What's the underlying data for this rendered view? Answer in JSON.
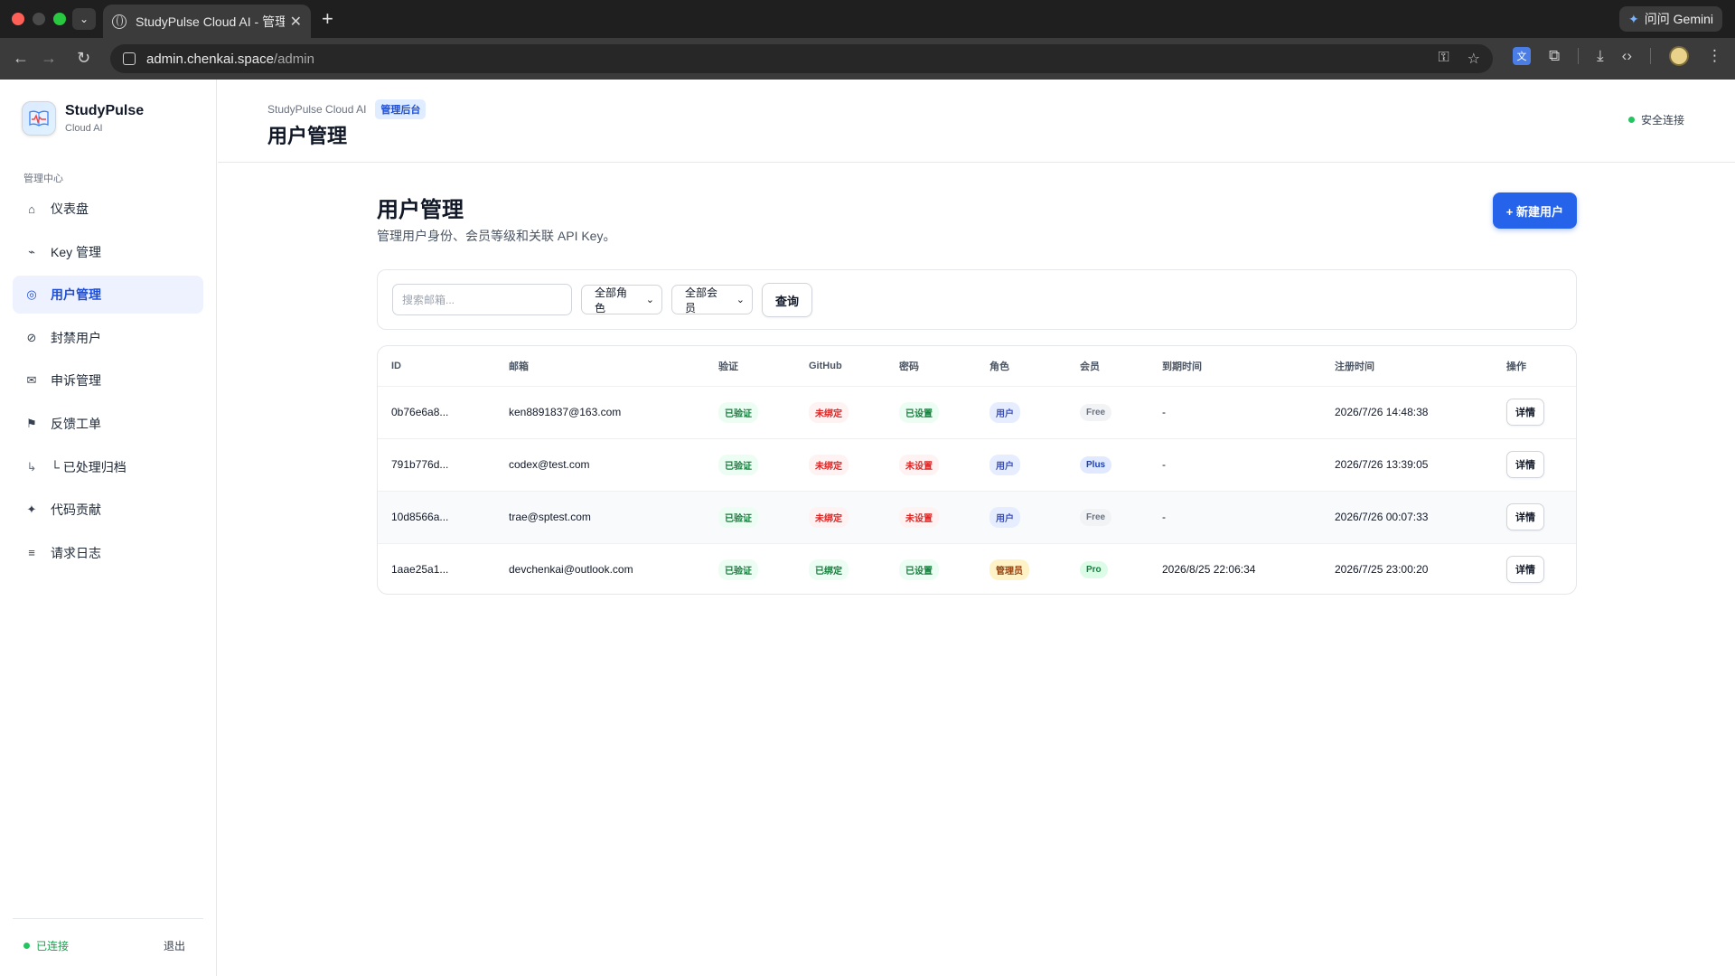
{
  "browser": {
    "tab_title": "StudyPulse Cloud AI - 管理后台",
    "tab_close": "✕",
    "url_host": "admin.chenkai.space",
    "url_path": "/admin",
    "gemini_label": "问问 Gemini",
    "translate_glyph": "文"
  },
  "sidebar": {
    "brand_name": "StudyPulse",
    "brand_sub": "Cloud AI",
    "section_label": "管理中心",
    "items": [
      {
        "label": "仪表盘",
        "icon": "home-icon",
        "glyph": "⌂"
      },
      {
        "label": "Key 管理",
        "icon": "key-icon",
        "glyph": "⌁"
      },
      {
        "label": "用户管理",
        "icon": "users-icon",
        "glyph": "◎",
        "active": true
      },
      {
        "label": "封禁用户",
        "icon": "ban-icon",
        "glyph": "⊘"
      },
      {
        "label": "申诉管理",
        "icon": "mail-icon",
        "glyph": "✉"
      },
      {
        "label": "反馈工单",
        "icon": "flag-icon",
        "glyph": "⚑"
      },
      {
        "label": "└ 已处理归档",
        "icon": "archive-branch-icon",
        "glyph": "↳"
      },
      {
        "label": "代码贡献",
        "icon": "sparkle-icon",
        "glyph": "✦"
      },
      {
        "label": "请求日志",
        "icon": "list-icon",
        "glyph": "≡"
      }
    ],
    "status": "已连接",
    "logout": "退出"
  },
  "topbar": {
    "crumb_app": "StudyPulse Cloud AI",
    "crumb_badge": "管理后台",
    "title": "用户管理",
    "secure": "安全连接"
  },
  "page": {
    "title": "用户管理",
    "description": "管理用户身份、会员等级和关联 API Key。",
    "new_user_label": "+ 新建用户"
  },
  "filters": {
    "search_placeholder": "搜索邮箱...",
    "role_selected": "全部角色",
    "member_selected": "全部会员",
    "query_label": "查询"
  },
  "table": {
    "headers": [
      "ID",
      "邮箱",
      "验证",
      "GitHub",
      "密码",
      "角色",
      "会员",
      "到期时间",
      "注册时间",
      "操作"
    ],
    "detail_label": "详情",
    "rows": [
      {
        "id": "0b76e6a8...",
        "email": "ken8891837@163.com",
        "verify": "已验证",
        "github": "未绑定",
        "password": "已设置",
        "role": "用户",
        "member": "Free",
        "expire": "-",
        "register": "2026/7/26 14:48:38"
      },
      {
        "id": "791b776d...",
        "email": "codex@test.com",
        "verify": "已验证",
        "github": "未绑定",
        "password": "未设置",
        "role": "用户",
        "member": "Plus",
        "expire": "-",
        "register": "2026/7/26 13:39:05"
      },
      {
        "id": "10d8566a...",
        "email": "trae@sptest.com",
        "verify": "已验证",
        "github": "未绑定",
        "password": "未设置",
        "role": "用户",
        "member": "Free",
        "expire": "-",
        "register": "2026/7/26 00:07:33"
      },
      {
        "id": "1aae25a1...",
        "email": "devchenkai@outlook.com",
        "verify": "已验证",
        "github": "已绑定",
        "password": "已设置",
        "role": "管理员",
        "member": "Pro",
        "expire": "2026/8/25 22:06:34",
        "register": "2026/7/25 23:00:20"
      }
    ]
  }
}
